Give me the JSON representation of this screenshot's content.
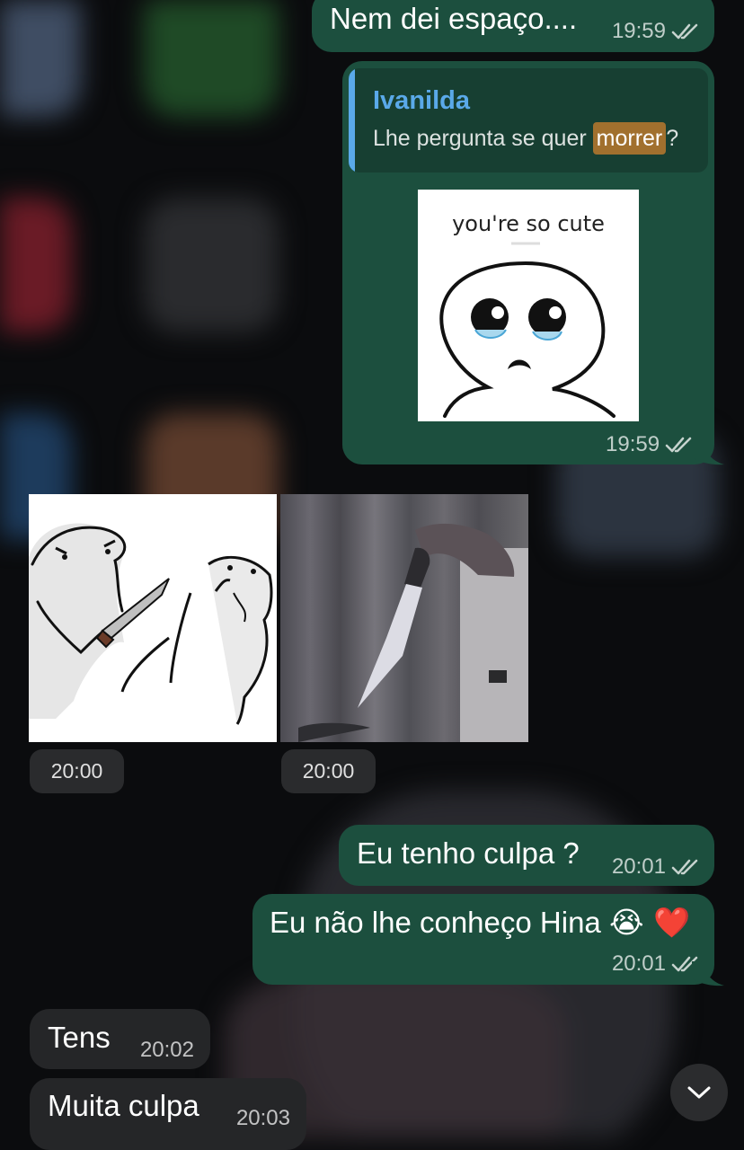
{
  "messages": [
    {
      "text": "Nem dei espaço....",
      "time": "19:59"
    },
    {
      "reply": {
        "name": "Ivanilda",
        "text_before": "Lhe pergunta se quer ",
        "highlight": "morrer",
        "text_after": "?"
      },
      "sticker_caption": "you're so cute",
      "time": "19:59"
    },
    {
      "time": "20:00"
    },
    {
      "time": "20:00"
    },
    {
      "text": "Eu tenho culpa ?",
      "time": "20:01"
    },
    {
      "text": "Eu não lhe conheço Hina",
      "emoji": "😭 ❤️",
      "time": "20:01"
    },
    {
      "text": "Tens",
      "time": "20:02"
    },
    {
      "text": "Muita culpa",
      "time": "20:03"
    }
  ],
  "icons": {
    "read_receipt": "double-check-icon",
    "scroll_down": "chevron-down-icon"
  },
  "colors": {
    "outgoing_bubble": "#1c4f3e",
    "incoming_bubble": "#252628",
    "reply_accent": "#5aa9e9",
    "highlight": "#a1702e"
  }
}
